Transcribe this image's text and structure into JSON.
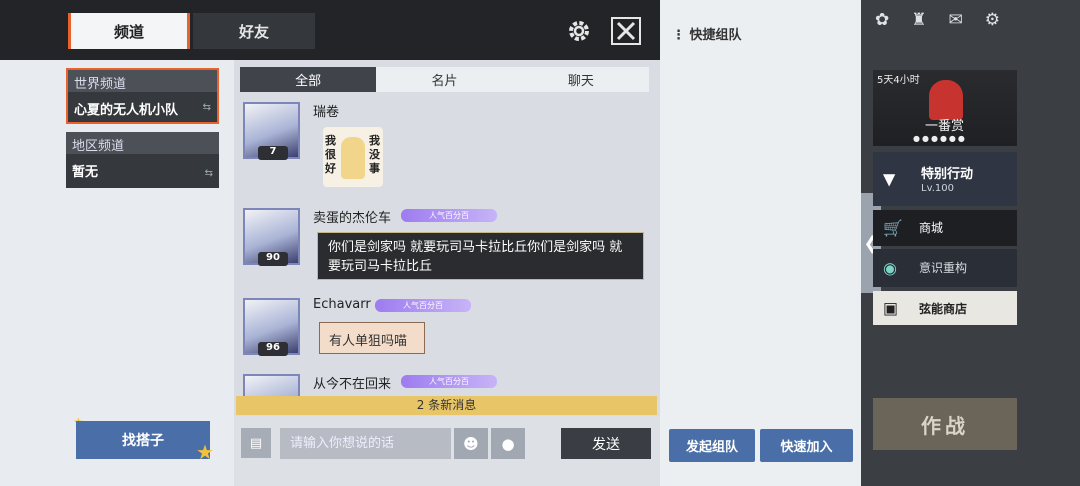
{
  "header": {
    "tab_channel": "频道",
    "tab_friends": "好友"
  },
  "channels": [
    {
      "title": "世界频道",
      "value": "心夏的无人机小队"
    },
    {
      "title": "地区频道",
      "value": "暂无"
    }
  ],
  "find_partner": "找搭子",
  "chat_tabs": [
    "全部",
    "名片",
    "聊天"
  ],
  "messages": [
    {
      "name": "瑞卷",
      "level": "7",
      "sticker_text_left": "我很好",
      "sticker_text_right": "我没事"
    },
    {
      "name": "卖蛋的杰伦车",
      "level": "90",
      "badge": "人气百分百",
      "text": "你们是剑家吗 就要玩司马卡拉比丘你们是剑家吗 就要玩司马卡拉比丘"
    },
    {
      "name": "Echavarr",
      "level": "96",
      "badge": "人气百分百",
      "text": "有人单狙吗喵"
    },
    {
      "name": "从今不在回来",
      "badge": "人气百分百"
    }
  ],
  "new_messages": "2 条新消息",
  "input": {
    "placeholder": "请输入你想说的话"
  },
  "send": "发送",
  "quick_team": {
    "title": "快捷组队",
    "start": "发起组队",
    "join": "快速加入"
  },
  "game_menu": {
    "event_timer": "5天4小时",
    "event_banner": "一番赏",
    "special": "特别行动",
    "special_level": "Lv.100",
    "shop": "商城",
    "mind": "意识重构",
    "string_shop": "弦能商店",
    "battle": "作战"
  },
  "colors": {
    "accent": "#e8632c",
    "primary_button": "#4a6fa8",
    "new_msg_bar": "#e8c668",
    "popularity_badge": "#9d7cf0"
  }
}
